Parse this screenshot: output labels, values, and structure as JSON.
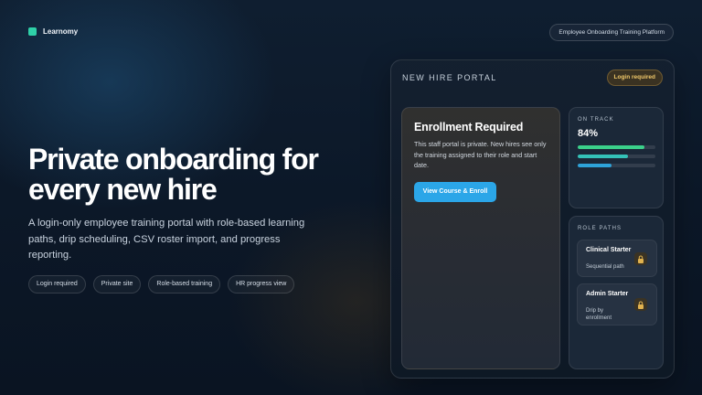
{
  "brand": {
    "name": "Learnomy",
    "accent": "#2fd0a8"
  },
  "header": {
    "platform_label": "Employee Onboarding Training Platform"
  },
  "hero": {
    "title_line1": "Private onboarding for",
    "title_line2": "every new hire",
    "description": "A login-only employee training portal with role-based learning paths, drip scheduling, CSV roster import, and progress reporting."
  },
  "chips": [
    "Login required",
    "Private site",
    "Role-based training",
    "HR progress view"
  ],
  "portal": {
    "title": "NEW HIRE PORTAL",
    "badge": "Login required",
    "enrollment": {
      "heading": "Enrollment Required",
      "body": "This staff portal is private. New hires see only the training assigned to their role and start date.",
      "button": "View Course & Enroll"
    },
    "on_track": {
      "label": "ON TRACK",
      "value": "84%",
      "bars": [
        {
          "fill": 0.86,
          "color": "#3bd18a"
        },
        {
          "fill": 0.65,
          "color": "#34c2b8"
        },
        {
          "fill": 0.43,
          "color": "#2ea3d9"
        }
      ]
    },
    "role_paths": {
      "label": "ROLE PATHS",
      "items": [
        {
          "name": "Clinical Starter",
          "detail": "Sequential path",
          "icon": "lock-icon"
        },
        {
          "name": "Admin Starter",
          "detail": "Drip by enrollment",
          "icon": "lock-icon"
        }
      ]
    }
  },
  "colors": {
    "primary_button": "#2ba6e8",
    "badge_text": "#f0c86a",
    "lock": "#e0b24f"
  }
}
